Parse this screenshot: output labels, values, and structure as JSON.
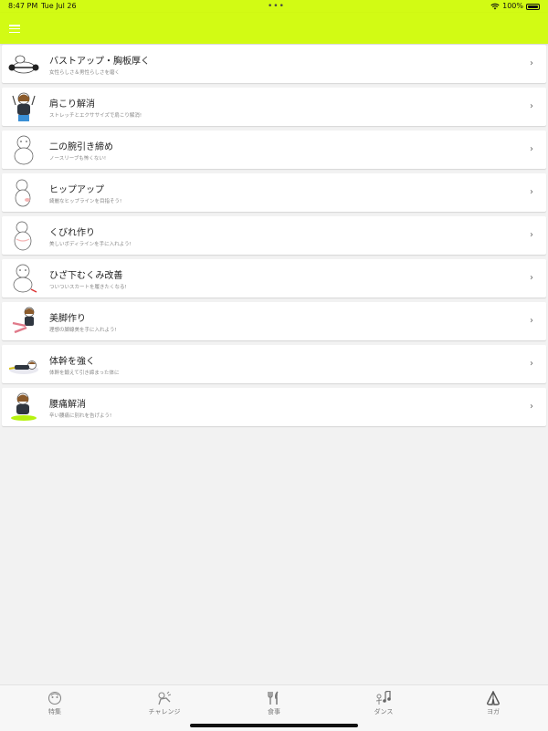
{
  "status_bar": {
    "time": "8:47 PM",
    "date": "Tue Jul 26",
    "battery": "100%"
  },
  "menu": [
    {
      "title": "バストアップ・胸板厚く",
      "subtitle": "女性らしさ＆男性らしさを磨く"
    },
    {
      "title": "肩こり解消",
      "subtitle": "ストレッチとエクササイズで肩こり解消!"
    },
    {
      "title": "二の腕引き締め",
      "subtitle": "ノースリーブも怖くない!"
    },
    {
      "title": "ヒップアップ",
      "subtitle": "綺麗なヒップラインを目指そう!"
    },
    {
      "title": "くびれ作り",
      "subtitle": "美しいボディラインを手に入れよう!"
    },
    {
      "title": "ひざ下むくみ改善",
      "subtitle": "ついついスカートを履きたくなる!"
    },
    {
      "title": "美脚作り",
      "subtitle": "理想の脚線美を手に入れよう!"
    },
    {
      "title": "体幹を強く",
      "subtitle": "体幹を鍛えて引き締まった体に"
    },
    {
      "title": "腰痛解消",
      "subtitle": "辛い腰痛に別れを告げよう!"
    }
  ],
  "tabs": [
    {
      "label": "特集",
      "icon": "feature-icon"
    },
    {
      "label": "チャレンジ",
      "icon": "challenge-icon"
    },
    {
      "label": "食事",
      "icon": "meal-icon"
    },
    {
      "label": "ダンス",
      "icon": "dance-icon"
    },
    {
      "label": "ヨガ",
      "icon": "yoga-icon"
    }
  ],
  "colors": {
    "accent": "#d2fb14",
    "background": "#f2f2f2"
  }
}
